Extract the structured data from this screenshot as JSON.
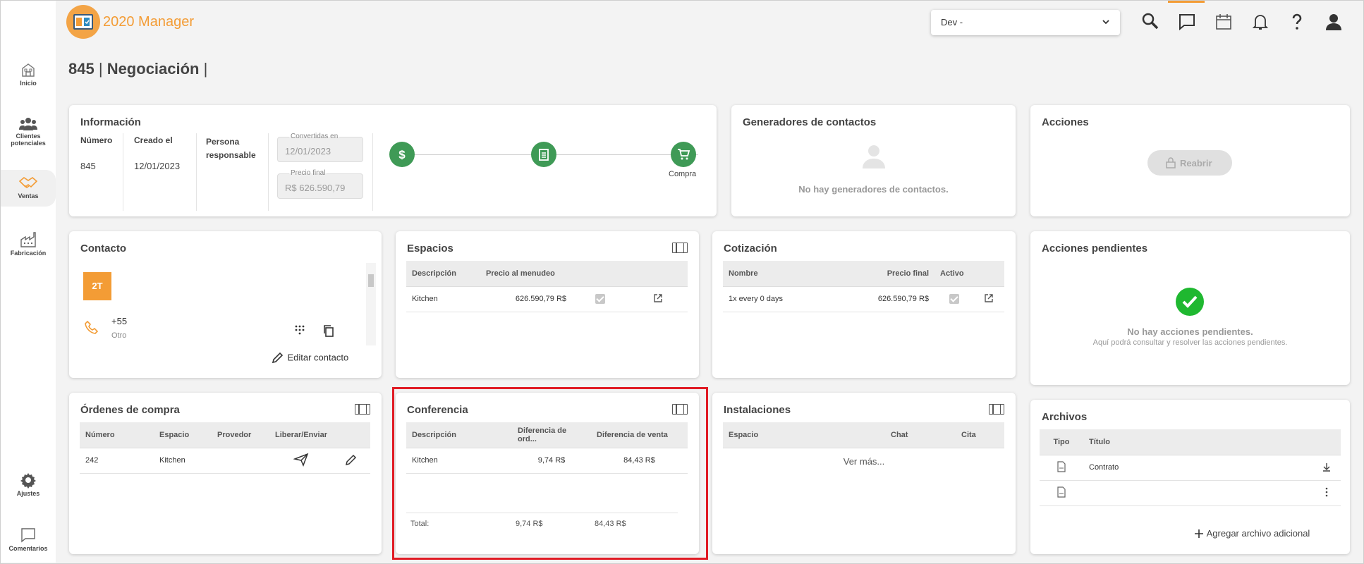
{
  "app": {
    "logo_prefix": "2",
    "logo_rest": "O2O Manager",
    "logo_text": "2020 Manager"
  },
  "header": {
    "env_select_value": "Dev -"
  },
  "sidebar": {
    "items": [
      {
        "label": "Inicio"
      },
      {
        "label": "Clientes potenciales"
      },
      {
        "label": "Ventas"
      },
      {
        "label": "Fabricación"
      },
      {
        "label": "Ajustes"
      },
      {
        "label": "Comentarios"
      }
    ]
  },
  "page": {
    "id": "845",
    "separator": "|",
    "stage": "Negociación",
    "trail": "|"
  },
  "informacion": {
    "title": "Información",
    "numero_label": "Número",
    "numero_value": "845",
    "creado_label": "Creado el",
    "creado_value": "12/01/2023",
    "persona_label": "Persona responsable",
    "convertidas_label": "Convertidas en",
    "convertidas_value": "12/01/2023",
    "precio_label": "Precio final",
    "precio_value": "R$ 626.590,79",
    "steps": [
      {
        "icon": "dollar-icon",
        "label": ""
      },
      {
        "icon": "clipboard-icon",
        "label": ""
      },
      {
        "icon": "cart-icon",
        "label": "Compra"
      }
    ]
  },
  "generadores": {
    "title": "Generadores de contactos",
    "empty": "No hay generadores de contactos."
  },
  "acciones": {
    "title": "Acciones",
    "reabrir": "Reabrir"
  },
  "contacto": {
    "title": "Contacto",
    "avatar": "2T",
    "phone": "+55",
    "phone_type": "Otro",
    "edit": "Editar contacto"
  },
  "espacios": {
    "title": "Espacios",
    "headers": [
      "Descripción",
      "Precio al menudeo"
    ],
    "rows": [
      {
        "desc": "Kitchen",
        "precio": "626.590,79 R$",
        "checked": true
      }
    ]
  },
  "cotizacion": {
    "title": "Cotización",
    "headers": [
      "Nombre",
      "Precio final",
      "Activo"
    ],
    "rows": [
      {
        "nombre": "1x every 0 days",
        "precio": "626.590,79 R$",
        "activo": true
      }
    ]
  },
  "pendientes": {
    "title": "Acciones pendientes",
    "empty": "No hay acciones pendientes.",
    "hint": "Aquí podrá consultar y resolver las acciones pendientes."
  },
  "ordenes": {
    "title": "Órdenes de compra",
    "headers": [
      "Número",
      "Espacio",
      "Provedor",
      "Liberar/Enviar"
    ],
    "rows": [
      {
        "numero": "242",
        "espacio": "Kitchen",
        "provedor": ""
      }
    ]
  },
  "conferencia": {
    "title": "Conferencia",
    "headers": [
      "Descripción",
      "Diferencia de ord...",
      "Diferencia de venta"
    ],
    "rows": [
      {
        "desc": "Kitchen",
        "ord": "9,74 R$",
        "venta": "84,43 R$"
      }
    ],
    "total_label": "Total:",
    "total_ord": "9,74 R$",
    "total_venta": "84,43 R$"
  },
  "instalaciones": {
    "title": "Instalaciones",
    "headers": [
      "Espacio",
      "Chat",
      "Cita"
    ],
    "ver_mas": "Ver más..."
  },
  "archivos": {
    "title": "Archivos",
    "headers": [
      "Tipo",
      "Título"
    ],
    "rows": [
      {
        "titulo": "Contrato"
      },
      {
        "titulo": ""
      }
    ],
    "add": "Agregar archivo adicional"
  },
  "colors": {
    "accent": "#f39c35",
    "success": "#3f9a56",
    "highlight": "#e01b24"
  }
}
